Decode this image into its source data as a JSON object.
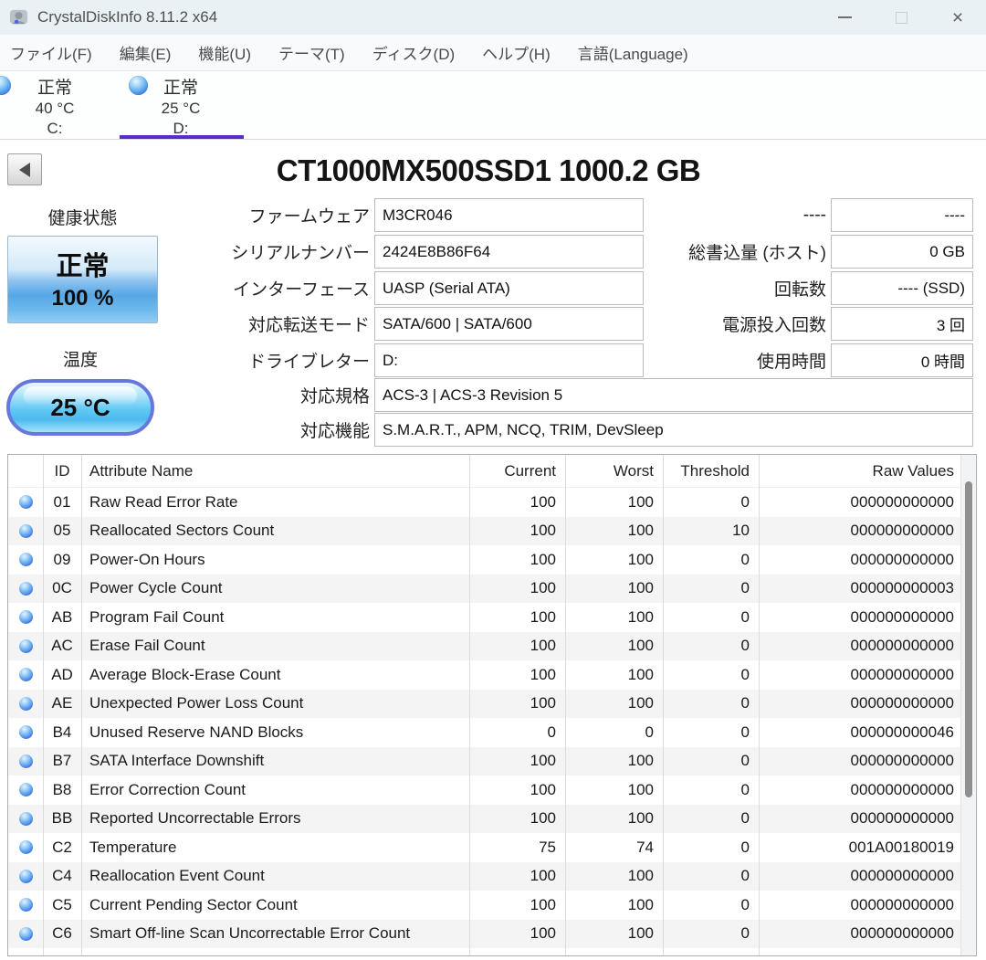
{
  "window": {
    "title": "CrystalDiskInfo 8.11.2 x64"
  },
  "menu": {
    "items": [
      "ファイル(F)",
      "編集(E)",
      "機能(U)",
      "テーマ(T)",
      "ディスク(D)",
      "ヘルプ(H)",
      "言語(Language)"
    ]
  },
  "drive_tabs": [
    {
      "status": "正常",
      "temperature": "40 °C",
      "drive_letter": "C:",
      "selected": false
    },
    {
      "status": "正常",
      "temperature": "25 °C",
      "drive_letter": "D:",
      "selected": true
    }
  ],
  "drive": {
    "title": "CT1000MX500SSD1 1000.2 GB",
    "health": {
      "label": "健康状態",
      "status": "正常",
      "percent": "100 %"
    },
    "temperature": {
      "label": "温度",
      "value": "25 °C"
    }
  },
  "info_fields_left": [
    {
      "label": "ファームウェア",
      "value": "M3CR046"
    },
    {
      "label": "シリアルナンバー",
      "value": "2424E8B86F64"
    },
    {
      "label": "インターフェース",
      "value": "UASP (Serial ATA)"
    },
    {
      "label": "対応転送モード",
      "value": "SATA/600 | SATA/600"
    },
    {
      "label": "ドライブレター",
      "value": "D:"
    },
    {
      "label": "対応規格",
      "value": "ACS-3 | ACS-3 Revision 5"
    },
    {
      "label": "対応機能",
      "value": "S.M.A.R.T., APM, NCQ, TRIM, DevSleep"
    }
  ],
  "info_fields_right": [
    {
      "label": "----",
      "value": "----"
    },
    {
      "label": "総書込量 (ホスト)",
      "value": "0 GB"
    },
    {
      "label": "回転数",
      "value": "---- (SSD)"
    },
    {
      "label": "電源投入回数",
      "value": "3 回"
    },
    {
      "label": "使用時間",
      "value": "0 時間"
    }
  ],
  "smart_table": {
    "headers": {
      "id": "ID",
      "name": "Attribute Name",
      "current": "Current",
      "worst": "Worst",
      "threshold": "Threshold",
      "raw": "Raw Values"
    },
    "rows": [
      {
        "id": "01",
        "name": "Raw Read Error Rate",
        "current": "100",
        "worst": "100",
        "threshold": "0",
        "raw": "000000000000"
      },
      {
        "id": "05",
        "name": "Reallocated Sectors Count",
        "current": "100",
        "worst": "100",
        "threshold": "10",
        "raw": "000000000000"
      },
      {
        "id": "09",
        "name": "Power-On Hours",
        "current": "100",
        "worst": "100",
        "threshold": "0",
        "raw": "000000000000"
      },
      {
        "id": "0C",
        "name": "Power Cycle Count",
        "current": "100",
        "worst": "100",
        "threshold": "0",
        "raw": "000000000003"
      },
      {
        "id": "AB",
        "name": "Program Fail Count",
        "current": "100",
        "worst": "100",
        "threshold": "0",
        "raw": "000000000000"
      },
      {
        "id": "AC",
        "name": "Erase Fail Count",
        "current": "100",
        "worst": "100",
        "threshold": "0",
        "raw": "000000000000"
      },
      {
        "id": "AD",
        "name": "Average Block-Erase Count",
        "current": "100",
        "worst": "100",
        "threshold": "0",
        "raw": "000000000000"
      },
      {
        "id": "AE",
        "name": "Unexpected Power Loss Count",
        "current": "100",
        "worst": "100",
        "threshold": "0",
        "raw": "000000000000"
      },
      {
        "id": "B4",
        "name": "Unused Reserve NAND Blocks",
        "current": "0",
        "worst": "0",
        "threshold": "0",
        "raw": "000000000046"
      },
      {
        "id": "B7",
        "name": "SATA Interface Downshift",
        "current": "100",
        "worst": "100",
        "threshold": "0",
        "raw": "000000000000"
      },
      {
        "id": "B8",
        "name": "Error Correction Count",
        "current": "100",
        "worst": "100",
        "threshold": "0",
        "raw": "000000000000"
      },
      {
        "id": "BB",
        "name": "Reported Uncorrectable Errors",
        "current": "100",
        "worst": "100",
        "threshold": "0",
        "raw": "000000000000"
      },
      {
        "id": "C2",
        "name": "Temperature",
        "current": "75",
        "worst": "74",
        "threshold": "0",
        "raw": "001A00180019"
      },
      {
        "id": "C4",
        "name": "Reallocation Event Count",
        "current": "100",
        "worst": "100",
        "threshold": "0",
        "raw": "000000000000"
      },
      {
        "id": "C5",
        "name": "Current Pending Sector Count",
        "current": "100",
        "worst": "100",
        "threshold": "0",
        "raw": "000000000000"
      },
      {
        "id": "C6",
        "name": "Smart Off-line Scan Uncorrectable Error Count",
        "current": "100",
        "worst": "100",
        "threshold": "0",
        "raw": "000000000000"
      }
    ]
  },
  "colors": {
    "accent_purple": "#5b2dc8",
    "status_blue": "#4da3e8"
  }
}
